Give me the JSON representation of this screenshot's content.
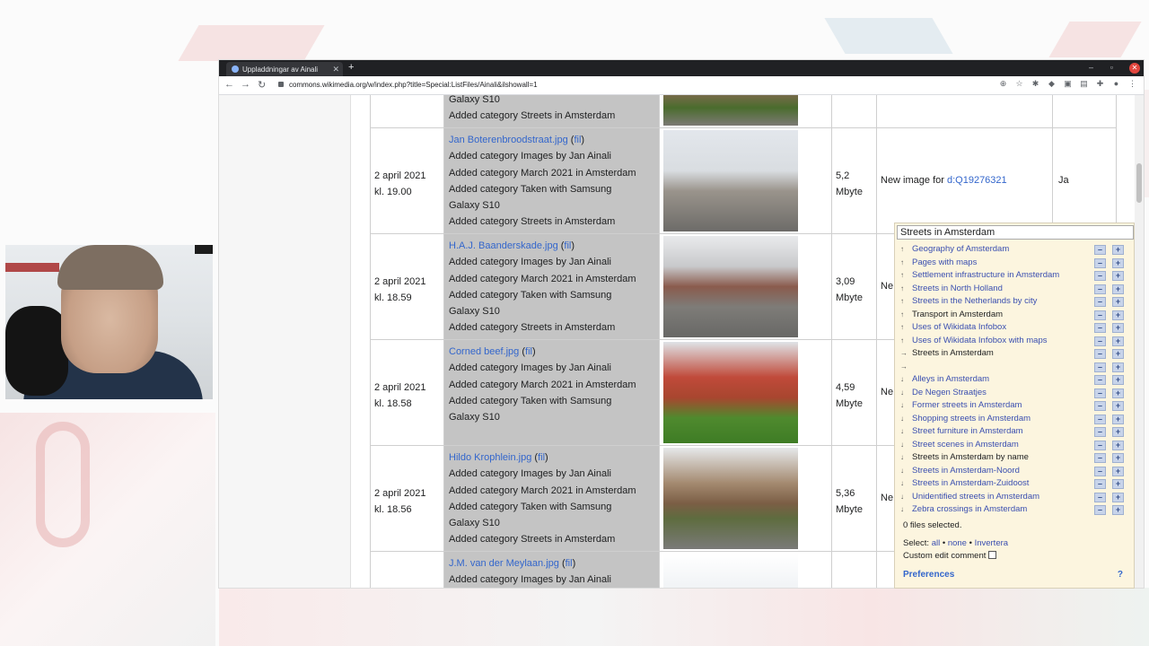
{
  "browser": {
    "tab_title": "Uppladdningar av Ainali",
    "new_tab": "+",
    "url": "commons.wikimedia.org/w/index.php?title=Special:ListFiles/Ainali&ilshowall=1",
    "minimize": "–",
    "maximize": "▫",
    "close": "✕"
  },
  "rows": [
    {
      "date": "",
      "time": "",
      "lines": [
        "Galaxy S10",
        "Added category Streets in Amsterdam"
      ],
      "size": "",
      "size_unit": "",
      "comment": "",
      "comment_link": "",
      "extra": ""
    },
    {
      "date": "2 april 2021",
      "time": "kl. 19.00",
      "file": "Jan Boterenbroodstraat.jpg",
      "fil": "fil",
      "lines": [
        "Added category Images by Jan Ainali",
        "Added category March 2021 in Amsterdam",
        "Added category Taken with Samsung",
        "Galaxy S10",
        "Added category Streets in Amsterdam"
      ],
      "size": "5,2",
      "size_unit": "Mbyte",
      "comment": "New image for ",
      "comment_link": "d:Q19276321",
      "extra": "Ja"
    },
    {
      "date": "2 april 2021",
      "time": "kl. 18.59",
      "file": "H.A.J. Baanderskade.jpg",
      "fil": "fil",
      "lines": [
        "Added category Images by Jan Ainali",
        "Added category March 2021 in Amsterdam",
        "Added category Taken with Samsung",
        "Galaxy S10",
        "Added category Streets in Amsterdam"
      ],
      "size": "3,09",
      "size_unit": "Mbyte",
      "comment": "Ne",
      "comment_link": "",
      "extra": ""
    },
    {
      "date": "2 april 2021",
      "time": "kl. 18.58",
      "file": "Corned beef.jpg",
      "fil": "fil",
      "lines": [
        "Added category Images by Jan Ainali",
        "Added category March 2021 in Amsterdam",
        "Added category Taken with Samsung",
        "Galaxy S10"
      ],
      "size": "4,59",
      "size_unit": "Mbyte",
      "comment": "Ne",
      "comment_link": "",
      "extra": ""
    },
    {
      "date": "2 april 2021",
      "time": "kl. 18.56",
      "file": "Hildo Krophlein.jpg",
      "fil": "fil",
      "lines": [
        "Added category Images by Jan Ainali",
        "Added category March 2021 in Amsterdam",
        "Added category Taken with Samsung",
        "Galaxy S10",
        "Added category Streets in Amsterdam"
      ],
      "size": "5,36",
      "size_unit": "Mbyte",
      "comment": "Ne",
      "comment_link": "",
      "extra": ""
    },
    {
      "date": "",
      "time": "",
      "file": "J.M. van der Meylaan.jpg",
      "fil": "fil",
      "lines": [
        "Added category Images by Jan Ainali"
      ],
      "size": "",
      "size_unit": "",
      "comment": "",
      "comment_link": "",
      "extra": ""
    }
  ],
  "catalot": {
    "search_value": "Streets in Amsterdam",
    "items": [
      {
        "arrow": "↑",
        "label": "Geography of Amsterdam",
        "style": "link"
      },
      {
        "arrow": "↑",
        "label": "Pages with maps",
        "style": "link"
      },
      {
        "arrow": "↑",
        "label": "Settlement infrastructure in Amsterdam",
        "style": "link"
      },
      {
        "arrow": "↑",
        "label": "Streets in North Holland",
        "style": "link"
      },
      {
        "arrow": "↑",
        "label": "Streets in the Netherlands by city",
        "style": "link"
      },
      {
        "arrow": "↑",
        "label": "Transport in Amsterdam",
        "style": "visited"
      },
      {
        "arrow": "↑",
        "label": "Uses of Wikidata Infobox",
        "style": "link"
      },
      {
        "arrow": "↑",
        "label": "Uses of Wikidata Infobox with maps",
        "style": "link"
      },
      {
        "arrow": "→",
        "label": "Streets in Amsterdam",
        "style": "current"
      },
      {
        "arrow": "→",
        "label": "",
        "style": "link"
      },
      {
        "arrow": "↓",
        "label": "Alleys in Amsterdam",
        "style": "link"
      },
      {
        "arrow": "↓",
        "label": "De Negen Straatjes",
        "style": "link"
      },
      {
        "arrow": "↓",
        "label": "Former streets in Amsterdam",
        "style": "link"
      },
      {
        "arrow": "↓",
        "label": "Shopping streets in Amsterdam",
        "style": "link"
      },
      {
        "arrow": "↓",
        "label": "Street furniture in Amsterdam",
        "style": "link"
      },
      {
        "arrow": "↓",
        "label": "Street scenes in Amsterdam",
        "style": "link"
      },
      {
        "arrow": "↓",
        "label": "Streets in Amsterdam by name",
        "style": "visited"
      },
      {
        "arrow": "↓",
        "label": "Streets in Amsterdam-Noord",
        "style": "link"
      },
      {
        "arrow": "↓",
        "label": "Streets in Amsterdam-Zuidoost",
        "style": "link"
      },
      {
        "arrow": "↓",
        "label": "Unidentified streets in Amsterdam",
        "style": "link"
      },
      {
        "arrow": "↓",
        "label": "Zebra crossings in Amsterdam",
        "style": "link"
      }
    ],
    "minus": "–",
    "plus": "+",
    "files_selected": "0 files selected.",
    "select_label": "Select:",
    "select_all": "all",
    "select_none": "none",
    "select_invert": "Invertera",
    "bullet": "•",
    "custom_comment": "Custom edit comment",
    "preferences": "Preferences",
    "help": "?"
  }
}
